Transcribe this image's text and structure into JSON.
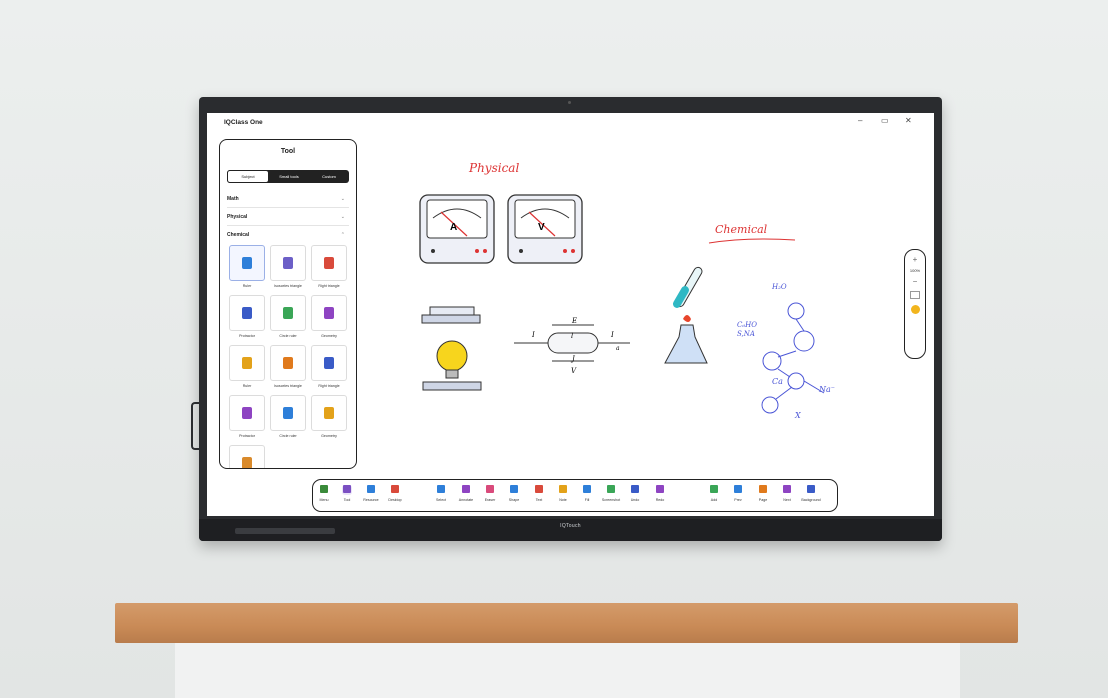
{
  "app": {
    "title": "IQClass One",
    "brand": "IQTouch"
  },
  "window_controls": {
    "minimize": "–",
    "maximize": "▭",
    "close": "✕"
  },
  "tool_panel": {
    "title": "Tool",
    "tabs": [
      {
        "label": "Subject",
        "active": true
      },
      {
        "label": "Small tools",
        "active": false
      },
      {
        "label": "Custom",
        "active": false
      }
    ],
    "categories": [
      {
        "label": "Math",
        "chevron": "⌄"
      },
      {
        "label": "Physical",
        "chevron": "⌄"
      },
      {
        "label": "Chemical",
        "chevron": "⌃"
      }
    ],
    "items": [
      {
        "label": "Ruler",
        "icon": "beaker-icon",
        "color": "#2e7fd9"
      },
      {
        "label": "Isosceles triangle",
        "icon": "flask-icon",
        "color": "#6c5fc7"
      },
      {
        "label": "Right triangle",
        "icon": "test-tube-icon",
        "color": "#d94a3b"
      },
      {
        "label": "Protractor",
        "icon": "magnet-icon",
        "color": "#3a5bc7"
      },
      {
        "label": "Circle ruler",
        "icon": "bottle-icon",
        "color": "#3aa657"
      },
      {
        "label": "Geometry",
        "icon": "round-flask-icon",
        "color": "#8e44c2"
      },
      {
        "label": "Ruler",
        "icon": "funnel-icon",
        "color": "#e3a21a"
      },
      {
        "label": "Isosceles triangle",
        "icon": "pin-icon",
        "color": "#e07a1c"
      },
      {
        "label": "Right triangle",
        "icon": "stand-icon",
        "color": "#3a5bc7"
      },
      {
        "label": "Protractor",
        "icon": "pyramid-icon",
        "color": "#8e44c2"
      },
      {
        "label": "Circle ruler",
        "icon": "thermometer-icon",
        "color": "#2e7fd9"
      },
      {
        "label": "Geometry",
        "icon": "dropper-icon",
        "color": "#e3a21a"
      },
      {
        "label": "",
        "icon": "textured-block-icon",
        "color": "#d98a2b"
      }
    ]
  },
  "canvas": {
    "annotations": {
      "physical": "Physical",
      "chemical": "Chemical"
    },
    "meters": [
      {
        "label": "A"
      },
      {
        "label": "V"
      }
    ],
    "wire_labels": {
      "e": "E",
      "j": "J",
      "i_left": "I",
      "i_right": "I",
      "i_mid": "l",
      "v": "V",
      "a": "a"
    },
    "chem_notes": {
      "h2o": "H₂O",
      "formula1": "C₆HO",
      "formula2": "S,NA",
      "ca": "Ca",
      "na": "Na⁻",
      "x": "X"
    }
  },
  "zoom": {
    "plus": "+",
    "minus": "−",
    "level": "100%"
  },
  "toolbar": {
    "items": [
      {
        "label": "Menu",
        "icon": "menu-icon",
        "color": "#3a8a3a"
      },
      {
        "label": "Tool",
        "icon": "toolbox-icon",
        "color": "#7b4fc2",
        "active": true
      },
      {
        "label": "Resource",
        "icon": "resource-icon",
        "color": "#2e7fd9"
      },
      {
        "label": "Desktop",
        "icon": "desktop-icon",
        "color": "#d94a3b"
      },
      {
        "label": "Select",
        "icon": "cursor-icon",
        "color": "#2e7fd9"
      },
      {
        "label": "Annotate",
        "icon": "pen-icon",
        "color": "#8e44c2"
      },
      {
        "label": "Eraser",
        "icon": "eraser-icon",
        "color": "#d94a7b"
      },
      {
        "label": "Shape",
        "icon": "triangle-icon",
        "color": "#2e7fd9"
      },
      {
        "label": "Text",
        "icon": "text-icon",
        "color": "#d94a3b"
      },
      {
        "label": "Note",
        "icon": "note-icon",
        "color": "#e3a21a"
      },
      {
        "label": "Fill",
        "icon": "fill-icon",
        "color": "#2e7fd9"
      },
      {
        "label": "Screenshot",
        "icon": "screenshot-icon",
        "color": "#3aa657"
      },
      {
        "label": "Undo",
        "icon": "undo-icon",
        "color": "#3a5bc7"
      },
      {
        "label": "Redo",
        "icon": "redo-icon",
        "color": "#8e44c2"
      },
      {
        "label": "Add",
        "icon": "add-page-icon",
        "color": "#3aa657"
      },
      {
        "label": "Prev",
        "icon": "prev-icon",
        "color": "#2e7fd9"
      },
      {
        "label": "Page",
        "icon": "page-icon",
        "color": "#e07a1c"
      },
      {
        "label": "Next",
        "icon": "next-icon",
        "color": "#8e44c2"
      },
      {
        "label": "Background",
        "icon": "background-icon",
        "color": "#3a5bc7"
      }
    ]
  }
}
